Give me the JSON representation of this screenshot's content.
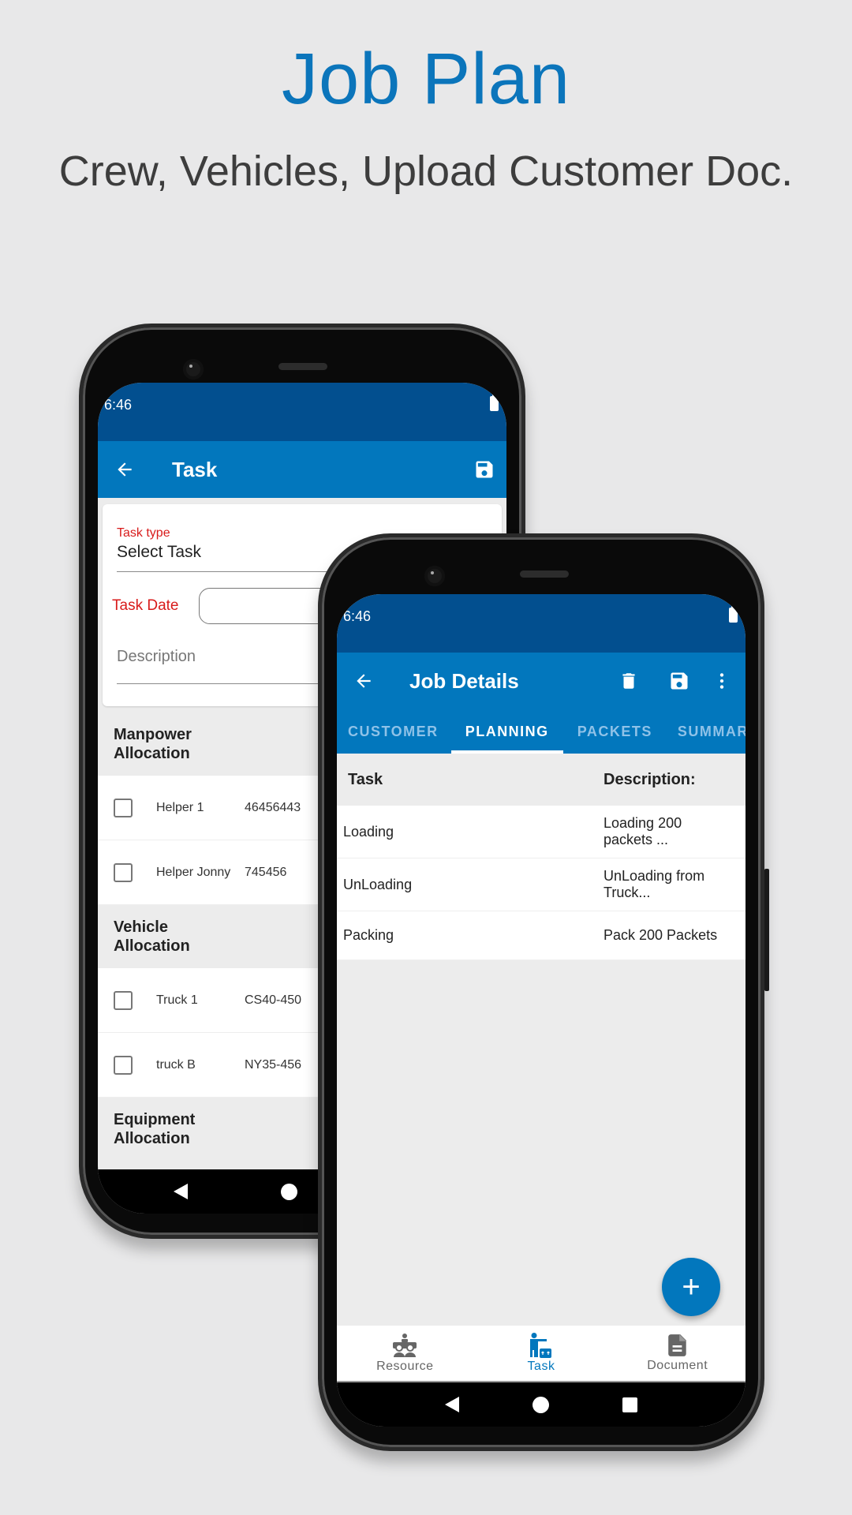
{
  "promo": {
    "title": "Job Plan",
    "subtitle": "Crew, Vehicles, Upload Customer Doc."
  },
  "colors": {
    "brand": "#0277bd",
    "status_bar": "#024f8f",
    "required_label": "#d81b1b",
    "headline": "#0b75bb"
  },
  "back_phone": {
    "status_time": "6:46",
    "appbar": {
      "title": "Task",
      "back_icon": "arrow-left-icon",
      "save_icon": "save-icon"
    },
    "form": {
      "task_type_label": "Task type",
      "task_type_value": "Select Task",
      "task_date_label": "Task Date",
      "task_date_value": "",
      "description_placeholder": "Description"
    },
    "sections": [
      {
        "title": "Manpower Allocation",
        "rows": [
          {
            "name": "Helper 1",
            "id": "46456443",
            "checked": false
          },
          {
            "name": "Helper Jonny",
            "id": "745456",
            "checked": false
          }
        ]
      },
      {
        "title": "Vehicle Allocation",
        "rows": [
          {
            "name": "Truck 1",
            "id": "CS40-450",
            "checked": false
          },
          {
            "name": "truck B",
            "id": "NY35-456",
            "checked": false
          }
        ]
      },
      {
        "title": "Equipment Allocation",
        "rows": []
      }
    ]
  },
  "front_phone": {
    "status_time": "6:46",
    "appbar": {
      "title": "Job Details",
      "back_icon": "arrow-left-icon",
      "delete_icon": "trash-icon",
      "save_icon": "save-icon",
      "more_icon": "more-vertical-icon"
    },
    "tabs": [
      {
        "label": "CUSTOMER",
        "active": false
      },
      {
        "label": "PLANNING",
        "active": true
      },
      {
        "label": "PACKETS",
        "active": false
      },
      {
        "label": "SUMMARY",
        "active": false
      }
    ],
    "table": {
      "headers": [
        "Task",
        "Description:"
      ],
      "rows": [
        {
          "task": "Loading",
          "description": "Loading 200 packets ..."
        },
        {
          "task": "UnLoading",
          "description": "UnLoading from Truck..."
        },
        {
          "task": "Packing",
          "description": "Pack 200 Packets"
        }
      ]
    },
    "fab": {
      "label": "+",
      "icon": "plus-icon"
    },
    "bottom_nav": [
      {
        "label": "Resource",
        "icon": "resource-meeting-icon",
        "active": false
      },
      {
        "label": "Task",
        "icon": "task-worker-icon",
        "active": true
      },
      {
        "label": "Document",
        "icon": "document-icon",
        "active": false
      }
    ]
  }
}
